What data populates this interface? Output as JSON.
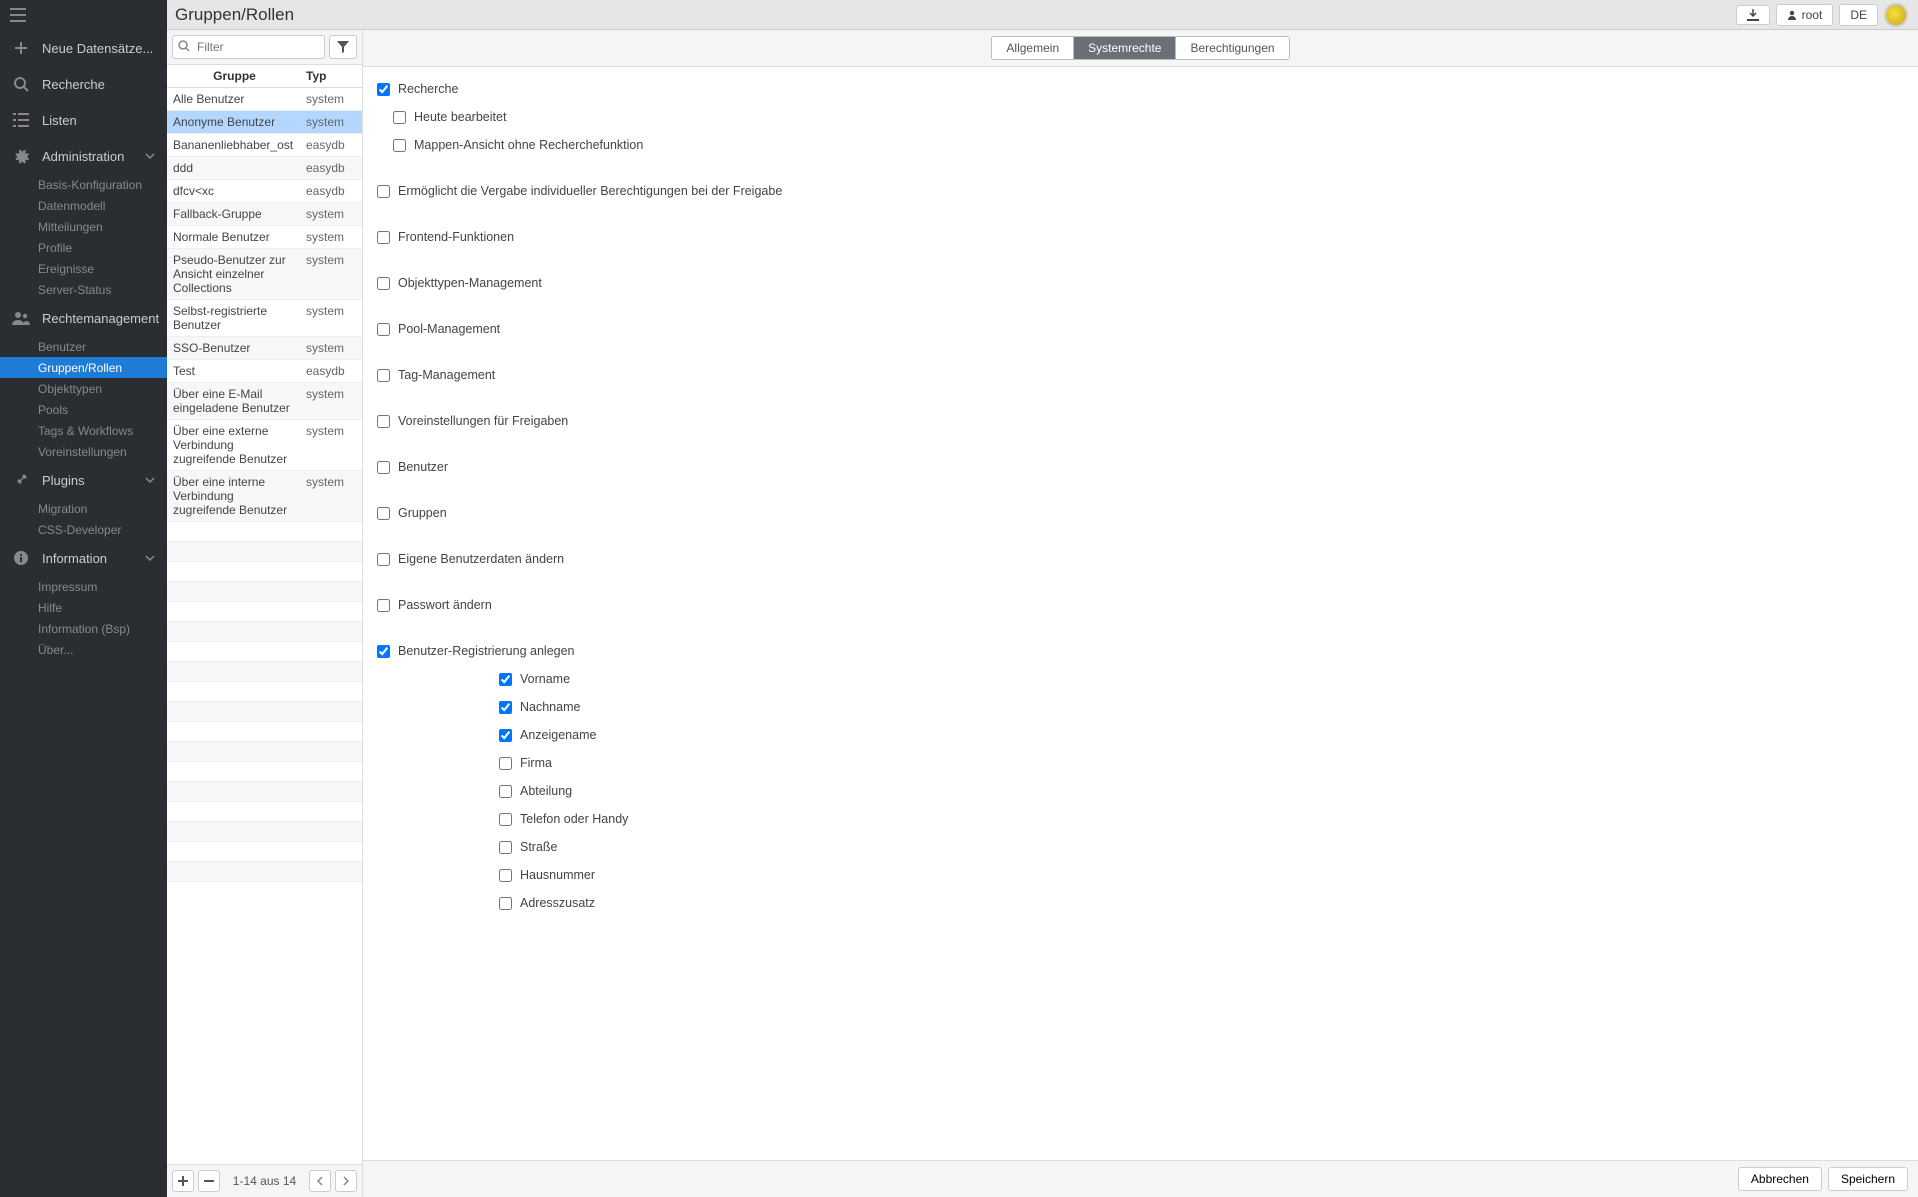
{
  "header": {
    "page_title": "Gruppen/Rollen",
    "download_label": "",
    "user_label": "root",
    "lang_label": "DE"
  },
  "sidebar": {
    "new_records": "Neue Datensätze...",
    "search": "Recherche",
    "lists": "Listen",
    "administration": "Administration",
    "admin_items": [
      "Basis-Konfiguration",
      "Datenmodell",
      "Mitteilungen",
      "Profile",
      "Ereignisse",
      "Server-Status"
    ],
    "rights": "Rechtemanagement",
    "rights_items": [
      "Benutzer",
      "Gruppen/Rollen",
      "Objekttypen",
      "Pools",
      "Tags & Workflows",
      "Voreinstellungen"
    ],
    "rights_active_index": 1,
    "plugins": "Plugins",
    "plugins_items": [
      "Migration",
      "CSS-Developer"
    ],
    "information": "Information",
    "info_items": [
      "Impressum",
      "Hilfe",
      "Information (Bsp)",
      "Über..."
    ]
  },
  "list": {
    "filter_placeholder": "Filter",
    "col_group": "Gruppe",
    "col_type": "Typ",
    "rows": [
      {
        "g": "Alle Benutzer",
        "t": "system"
      },
      {
        "g": "Anonyme Benutzer",
        "t": "system"
      },
      {
        "g": "Bananenliebhaber_ost",
        "t": "easydb"
      },
      {
        "g": "ddd",
        "t": "easydb"
      },
      {
        "g": "dfcv<xc",
        "t": "easydb"
      },
      {
        "g": "Fallback-Gruppe",
        "t": "system"
      },
      {
        "g": "Normale Benutzer",
        "t": "system"
      },
      {
        "g": "Pseudo-Benutzer zur Ansicht einzelner Collections",
        "t": "system"
      },
      {
        "g": "Selbst-registrierte Benutzer",
        "t": "system"
      },
      {
        "g": "SSO-Benutzer",
        "t": "system"
      },
      {
        "g": "Test",
        "t": "easydb"
      },
      {
        "g": "Über eine E-Mail eingeladene Benutzer",
        "t": "system"
      },
      {
        "g": "Über eine externe Verbindung zugreifende Benutzer",
        "t": "system"
      },
      {
        "g": "Über eine interne Verbindung zugreifende Benutzer",
        "t": "system"
      }
    ],
    "selected_index": 1,
    "count_text": "1-14 aus 14"
  },
  "tabs": {
    "general": "Allgemein",
    "system_rights": "Systemrechte",
    "permissions": "Berechtigungen",
    "active": 1
  },
  "perms": [
    {
      "label": "Recherche",
      "checked": true,
      "indent": 0
    },
    {
      "label": "Heute bearbeitet",
      "checked": false,
      "indent": 1
    },
    {
      "label": "Mappen-Ansicht ohne Recherchefunktion",
      "checked": false,
      "indent": 1
    },
    {
      "label": "Ermöglicht die Vergabe individueller Berechtigungen bei der Freigabe",
      "checked": false,
      "indent": 0
    },
    {
      "label": "Frontend-Funktionen",
      "checked": false,
      "indent": 0
    },
    {
      "label": "Objekttypen-Management",
      "checked": false,
      "indent": 0
    },
    {
      "label": "Pool-Management",
      "checked": false,
      "indent": 0
    },
    {
      "label": "Tag-Management",
      "checked": false,
      "indent": 0
    },
    {
      "label": "Voreinstellungen für Freigaben",
      "checked": false,
      "indent": 0
    },
    {
      "label": "Benutzer",
      "checked": false,
      "indent": 0
    },
    {
      "label": "Gruppen",
      "checked": false,
      "indent": 0
    },
    {
      "label": "Eigene Benutzerdaten ändern",
      "checked": false,
      "indent": 0
    },
    {
      "label": "Passwort ändern",
      "checked": false,
      "indent": 0
    },
    {
      "label": "Benutzer-Registrierung anlegen",
      "checked": true,
      "indent": 0
    },
    {
      "label": "Vorname",
      "checked": true,
      "indent": 2
    },
    {
      "label": "Nachname",
      "checked": true,
      "indent": 2
    },
    {
      "label": "Anzeigename",
      "checked": true,
      "indent": 2
    },
    {
      "label": "Firma",
      "checked": false,
      "indent": 2
    },
    {
      "label": "Abteilung",
      "checked": false,
      "indent": 2
    },
    {
      "label": "Telefon oder Handy",
      "checked": false,
      "indent": 2
    },
    {
      "label": "Straße",
      "checked": false,
      "indent": 2
    },
    {
      "label": "Hausnummer",
      "checked": false,
      "indent": 2
    },
    {
      "label": "Adresszusatz",
      "checked": false,
      "indent": 2
    }
  ],
  "footer": {
    "cancel": "Abbrechen",
    "save": "Speichern"
  }
}
